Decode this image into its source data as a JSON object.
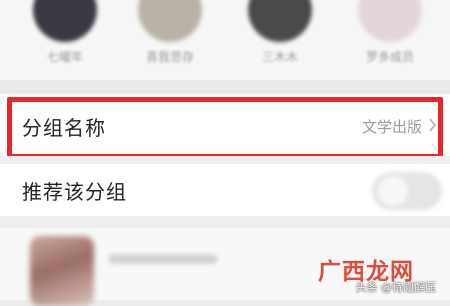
{
  "members": [
    {
      "name": "七曜年",
      "avatar_color": "#3a3a44"
    },
    {
      "name": "喜我思存",
      "avatar_color": "#b9b3a6"
    },
    {
      "name": "三木木",
      "avatar_color": "#4a4a4a"
    },
    {
      "name": "罗多成员",
      "avatar_color": "#e4d6d8"
    }
  ],
  "group_name_row": {
    "label": "分组名称",
    "value": "文学出版",
    "icon": "chevron-right-icon"
  },
  "recommend_row": {
    "label": "推荐该分组",
    "toggle_on": false
  },
  "watermark": {
    "brand": "广西龙网",
    "source": "头条 @待剐解压"
  },
  "colors": {
    "highlight": "#e8262b",
    "brand": "#e14b3b"
  }
}
